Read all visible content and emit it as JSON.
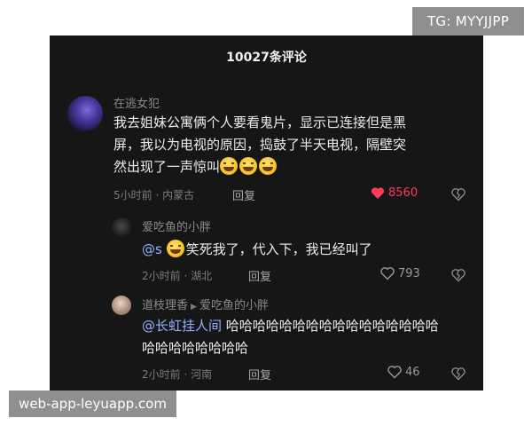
{
  "watermarks": {
    "top": "TG: MYYJJPP",
    "bottom": "web-app-leyuapp.com"
  },
  "panel": {
    "title": "10027条评论"
  },
  "comments": {
    "main": {
      "user": "在逃女犯",
      "text_line1": "我去姐妹公寓俩个人要看鬼片，显示已连接但是黑",
      "text_line2": "屏，我以为电视的原因，捣鼓了半天电视，隔壁突",
      "text_line3": "然出现了一声惊叫",
      "meta": "5小时前 · 内蒙古",
      "reply": "回复",
      "likes": "8560"
    },
    "reply1": {
      "user": "爱吃鱼的小胖",
      "mention": "@s",
      "text": "笑死我了，代入下，我已经叫了",
      "meta": "2小时前 · 湖北",
      "reply": "回复",
      "likes": "793"
    },
    "reply2": {
      "user": "道枝理香",
      "reply_to": "爱吃鱼的小胖",
      "mention": "@长虹挂人间",
      "text_line1": "哈哈哈哈哈哈哈哈哈哈哈哈哈哈哈哈",
      "text_line2": "哈哈哈哈哈哈哈哈",
      "meta": "2小时前 · 河南",
      "reply": "回复",
      "likes": "46"
    }
  },
  "icons": {
    "like_filled": "heart-filled-icon",
    "like_outline": "heart-outline-icon",
    "dislike": "broken-heart-icon",
    "emoji": "laughing-tears-emoji",
    "reply_arrow": "triangle-right-icon"
  },
  "colors": {
    "panel_bg": "#161616",
    "like_active": "#ff3b5c",
    "mention": "#8fb4ff",
    "watermark_bg": "#8f8f8f"
  }
}
